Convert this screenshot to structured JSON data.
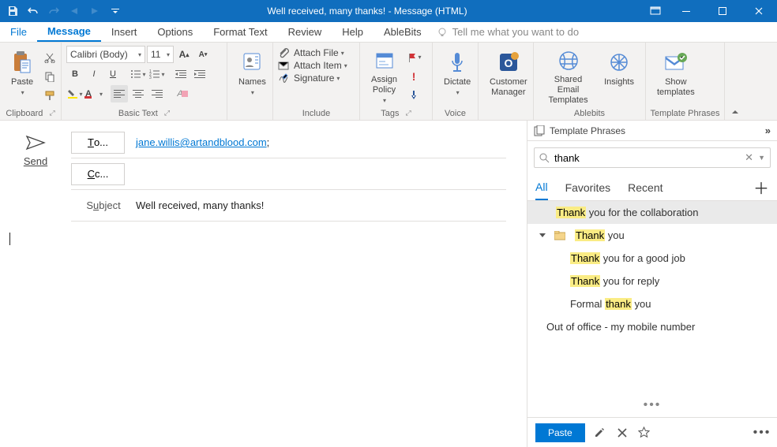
{
  "title": "Well received, many thanks!  -  Message (HTML)",
  "tabs": [
    "File",
    "Message",
    "Insert",
    "Options",
    "Format Text",
    "Review",
    "Help",
    "AbleBits"
  ],
  "tell_me": "Tell me what you want to do",
  "ribbon": {
    "clipboard": "Clipboard",
    "paste": "Paste",
    "basic_text": "Basic Text",
    "font_name": "Calibri (Body)",
    "font_size": "11",
    "names": "Names",
    "include": "Include",
    "attach_file": "Attach File",
    "attach_item": "Attach Item",
    "signature": "Signature",
    "tags": "Tags",
    "assign_policy": "Assign\nPolicy",
    "voice": "Voice",
    "dictate": "Dictate",
    "customer_mgr": "Customer\nManager",
    "ablebits": "Ablebits",
    "shared_email": "Shared Email\nTemplates",
    "insights": "Insights",
    "template_phrases_group": "Template Phrases",
    "show_templates": "Show\ntemplates"
  },
  "compose": {
    "send": "Send",
    "to": "To...",
    "cc": "Cc...",
    "subject_label": "Subject",
    "to_value": "jane.willis@artandblood.com",
    "subject_value": "Well received, many thanks!"
  },
  "tpane": {
    "header": "Template Phrases",
    "search_value": "thank",
    "tabs": [
      "All",
      "Favorites",
      "Recent"
    ],
    "items": [
      {
        "indent": 1,
        "hl": "Thank",
        "rest": " you for the collaboration",
        "sel": true,
        "folder": false
      },
      {
        "indent": 1,
        "hl": "Thank",
        "rest": " you",
        "folder": true
      },
      {
        "indent": 2,
        "hl": "Thank",
        "rest": " you for a good job"
      },
      {
        "indent": 2,
        "hl": "Thank",
        "rest": " you for reply"
      },
      {
        "indent": 2,
        "pre": "Formal ",
        "hl": "thank",
        "rest": " you"
      },
      {
        "indent": 0,
        "pre": "Out of office - my mobile number",
        "plain": true
      }
    ],
    "paste": "Paste"
  }
}
